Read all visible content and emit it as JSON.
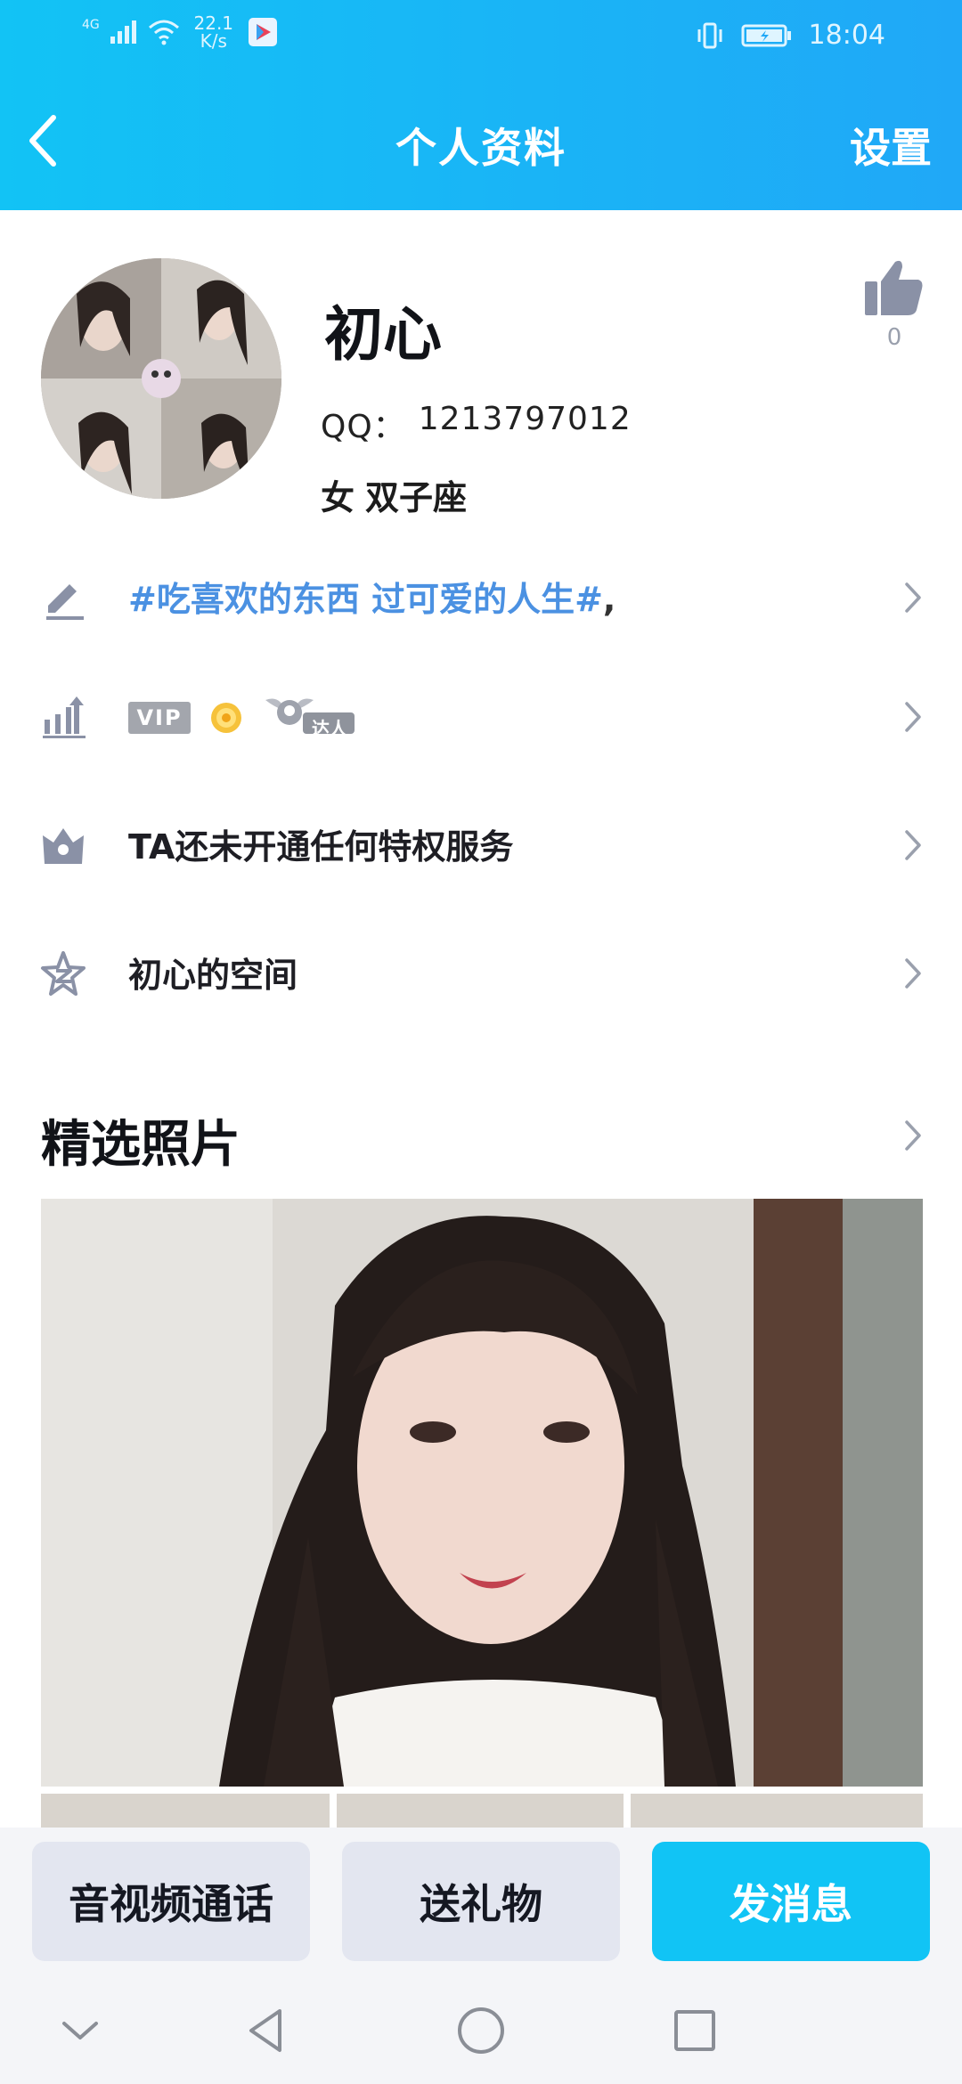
{
  "status_bar": {
    "network": "4G",
    "speed_value": "22.1",
    "speed_unit": "K/s",
    "time": "18:04"
  },
  "nav": {
    "title": "个人资料",
    "settings_label": "设置"
  },
  "profile": {
    "name": "初心",
    "qq_label": "QQ：",
    "qq_number": "1213797012",
    "gender": "女",
    "zodiac": "双子座",
    "like_count": "0"
  },
  "rows": {
    "signature_text": "#吃喜欢的东西 过可爱的人生#",
    "signature_suffix": ",",
    "vip_badge": "VIP",
    "daren_badge": "达人",
    "privilege_text": "TA还未开通任何特权服务",
    "space_text": "初心的空间"
  },
  "photos": {
    "section_title": "精选照片"
  },
  "actions": {
    "call_label": "音视频通话",
    "gift_label": "送礼物",
    "message_label": "发消息"
  },
  "colors": {
    "header_start": "#12c3f5",
    "header_end": "#20a8f7",
    "accent": "#11c4f5",
    "signature": "#4b91e2",
    "icon_gray": "#8a91a6"
  }
}
